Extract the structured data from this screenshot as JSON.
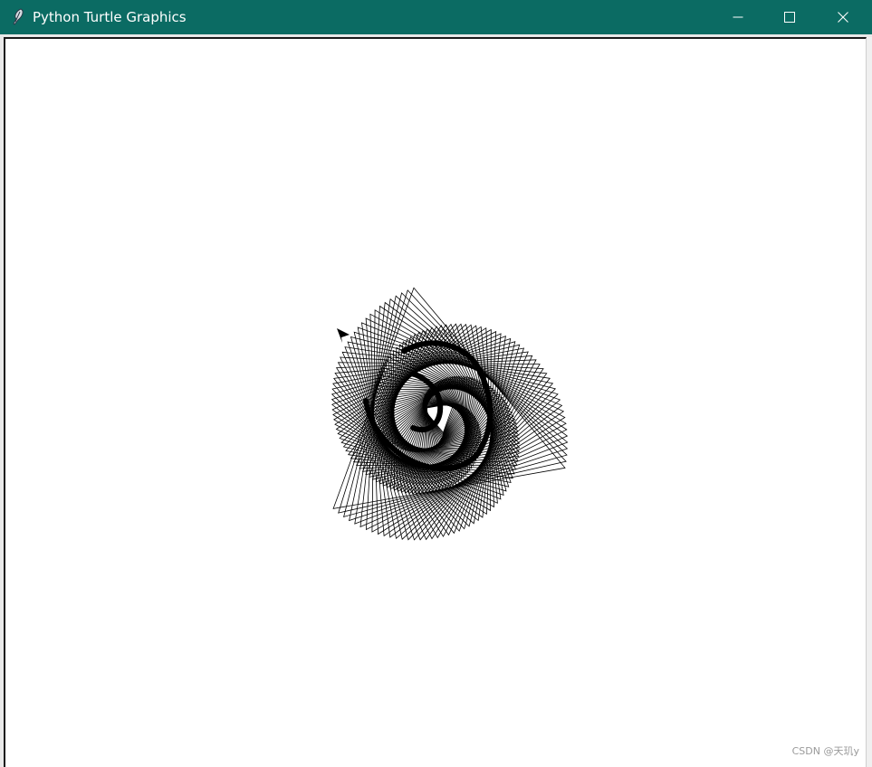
{
  "window": {
    "title": "Python Turtle Graphics",
    "titlebar_color": "#0b6b63",
    "title_color": "#ffffff",
    "icon": "feather-icon"
  },
  "controls": {
    "minimize_icon": "minimize-icon",
    "maximize_icon": "maximize-icon",
    "close_icon": "close-icon"
  },
  "canvas": {
    "background": "#ffffff",
    "pen_color": "#000000",
    "cursor_icon": "turtle-arrow-icon"
  },
  "watermark": {
    "text": "CSDN @天玑y"
  }
}
